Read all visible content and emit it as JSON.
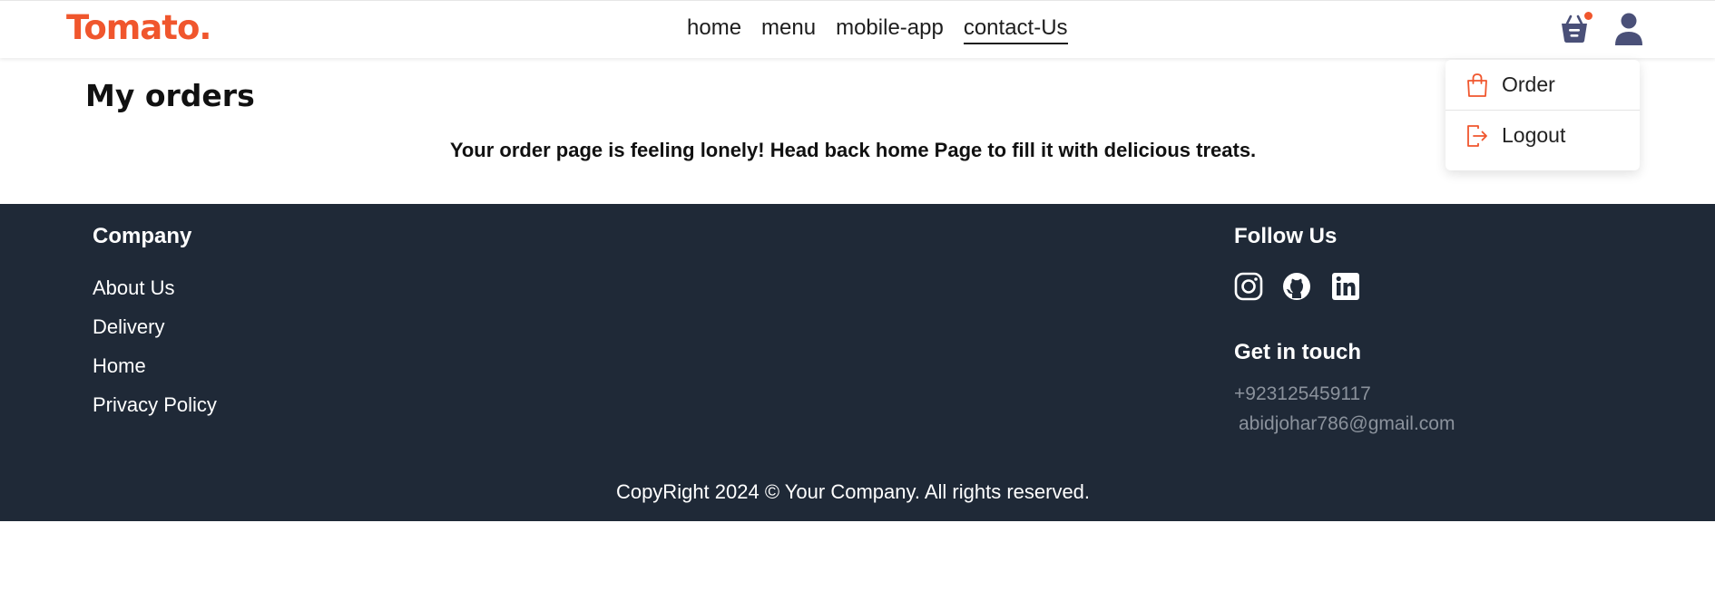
{
  "navbar": {
    "logo": "Tomato.",
    "links": [
      {
        "label": "home"
      },
      {
        "label": "menu"
      },
      {
        "label": "mobile-app"
      },
      {
        "label": "contact-Us",
        "active": true
      }
    ],
    "cart_icon": "basket-icon",
    "profile_icon": "user-icon",
    "cart_has_items": true
  },
  "dropdown": {
    "items": [
      {
        "label": "Order",
        "icon": "bag-icon"
      },
      {
        "label": "Logout",
        "icon": "logout-icon"
      }
    ]
  },
  "main": {
    "title": "My orders",
    "empty_message": "Your order page is feeling lonely! Head back home Page to fill it with delicious treats."
  },
  "footer": {
    "company_heading": "Company",
    "company_links": [
      "About Us",
      "Delivery",
      "Home",
      "Privacy Policy"
    ],
    "follow_heading": "Follow Us",
    "social_icons": [
      "instagram-icon",
      "github-icon",
      "linkedin-icon"
    ],
    "contact_heading": "Get in touch",
    "phone": "+923125459117",
    "email": "abidjohar786@gmail.com",
    "copyright": "CopyRight 2024 © Your Company. All rights reserved."
  },
  "colors": {
    "accent": "#f0562d",
    "footer_bg": "#1f2937",
    "icon_dark": "#4a5078",
    "muted_text": "#8b929c"
  }
}
